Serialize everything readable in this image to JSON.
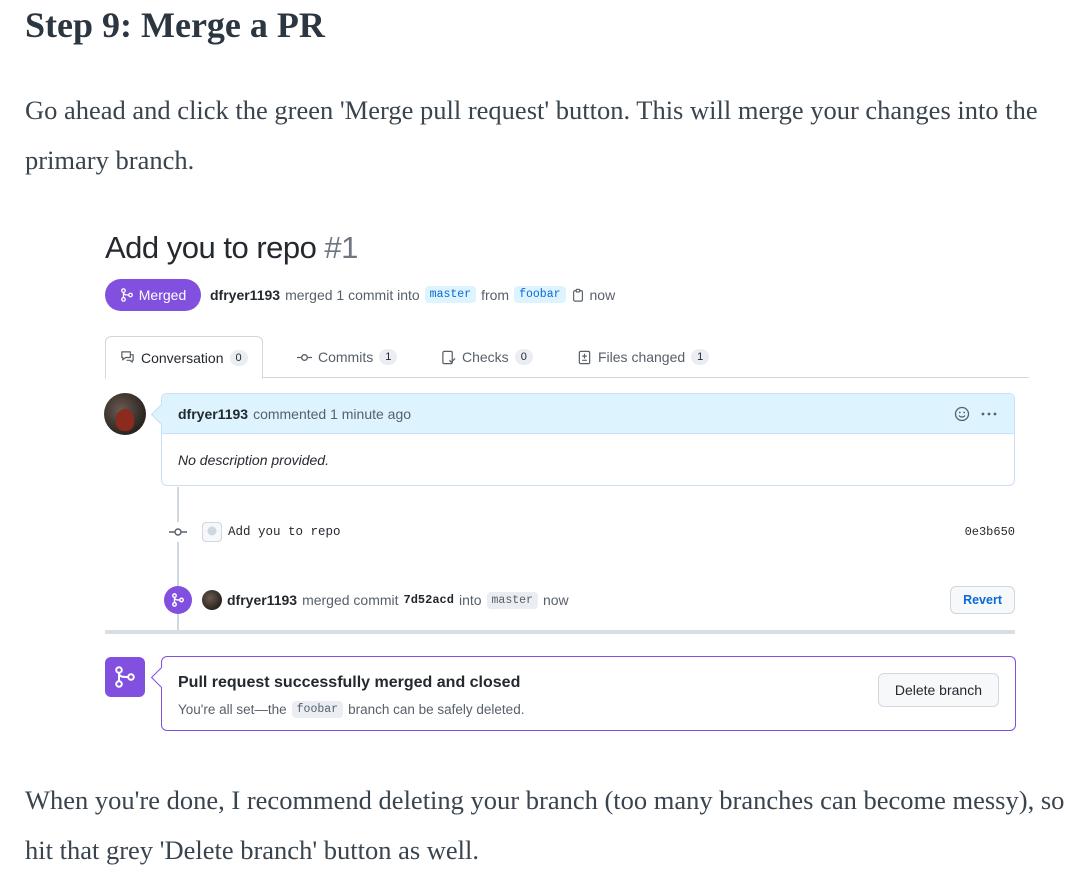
{
  "article": {
    "heading": "Step 9: Merge a PR",
    "para1": "Go ahead and click the green 'Merge pull request' button. This will merge your changes into the primary branch.",
    "para2": "When you're done, I recommend deleting your branch (too many branches can become messy), so hit that grey 'Delete branch' button as well."
  },
  "pr": {
    "title": "Add you to repo",
    "number": "#1",
    "status_badge": "Merged",
    "author": "dfryer1193",
    "merge_text": "merged 1 commit into",
    "base_branch": "master",
    "from_text": "from",
    "head_branch": "foobar",
    "time": "now"
  },
  "tabs": [
    {
      "label": "Conversation",
      "count": "0",
      "icon": "comment-discussion-icon"
    },
    {
      "label": "Commits",
      "count": "1",
      "icon": "git-commit-icon"
    },
    {
      "label": "Checks",
      "count": "0",
      "icon": "checklist-icon"
    },
    {
      "label": "Files changed",
      "count": "1",
      "icon": "file-diff-icon"
    }
  ],
  "comment": {
    "author": "dfryer1193",
    "meta": "commented 1 minute ago",
    "body": "No description provided."
  },
  "commit": {
    "message": "Add you to repo",
    "sha": "0e3b650"
  },
  "merge_event": {
    "author": "dfryer1193",
    "text": "merged commit",
    "sha": "7d52acd",
    "into": "into",
    "branch": "master",
    "time": "now",
    "revert_label": "Revert"
  },
  "merged_box": {
    "title": "Pull request successfully merged and closed",
    "sub_before": "You're all set—the",
    "branch": "foobar",
    "sub_after": "branch can be safely deleted.",
    "delete_label": "Delete branch"
  },
  "colors": {
    "merged_purple": "#8250df",
    "link_blue": "#0969da",
    "comment_header": "#ddf4ff"
  }
}
